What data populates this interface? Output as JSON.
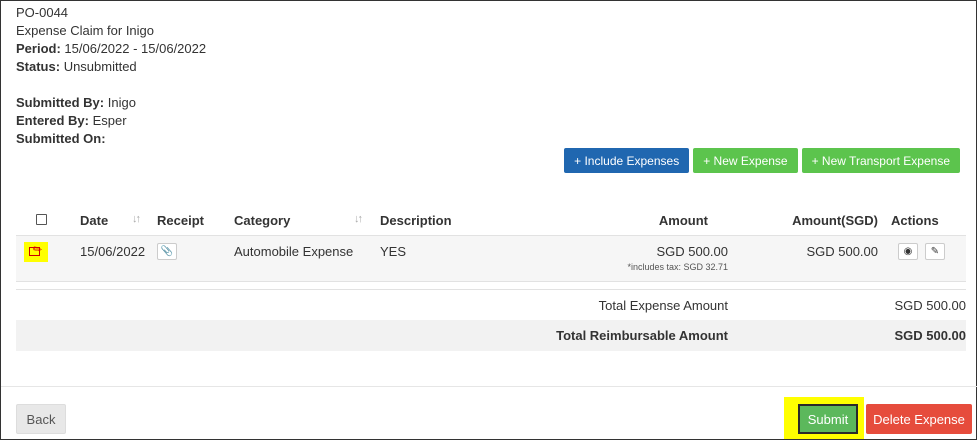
{
  "header": {
    "po_number": "PO-0044",
    "claim_title": "Expense Claim for Inigo",
    "period_label": "Period:",
    "period_value": "15/06/2022 - 15/06/2022",
    "status_label": "Status:",
    "status_value": "Unsubmitted",
    "submitted_by_label": "Submitted By:",
    "submitted_by_value": "Inigo",
    "entered_by_label": "Entered By:",
    "entered_by_value": "Esper",
    "submitted_on_label": "Submitted On:",
    "submitted_on_value": ""
  },
  "toolbar": {
    "include_expenses": "+ Include Expenses",
    "new_expense": "+ New Expense",
    "new_transport_expense": "+ New Transport Expense"
  },
  "table": {
    "headers": {
      "date": "Date",
      "receipt": "Receipt",
      "category": "Category",
      "description": "Description",
      "amount": "Amount",
      "amount_sgd": "Amount(SGD)",
      "actions": "Actions"
    },
    "rows": [
      {
        "date": "15/06/2022",
        "receipt_icon": "paperclip-icon",
        "category": "Automobile Expense",
        "description": "YES",
        "amount": "SGD 500.00",
        "tax_note": "*includes tax: SGD 32.71",
        "amount_sgd": "SGD 500.00"
      }
    ]
  },
  "totals": {
    "total_expense_label": "Total Expense Amount",
    "total_expense_value": "SGD 500.00",
    "total_reimbursable_label": "Total Reimbursable Amount",
    "total_reimbursable_value": "SGD 500.00"
  },
  "footer": {
    "back": "Back",
    "submit": "Submit",
    "delete": "Delete Expense"
  },
  "colors": {
    "primary_blue": "#2067b0",
    "green": "#5cc44d",
    "danger": "#e64c3c",
    "highlight": "#ffff00"
  }
}
